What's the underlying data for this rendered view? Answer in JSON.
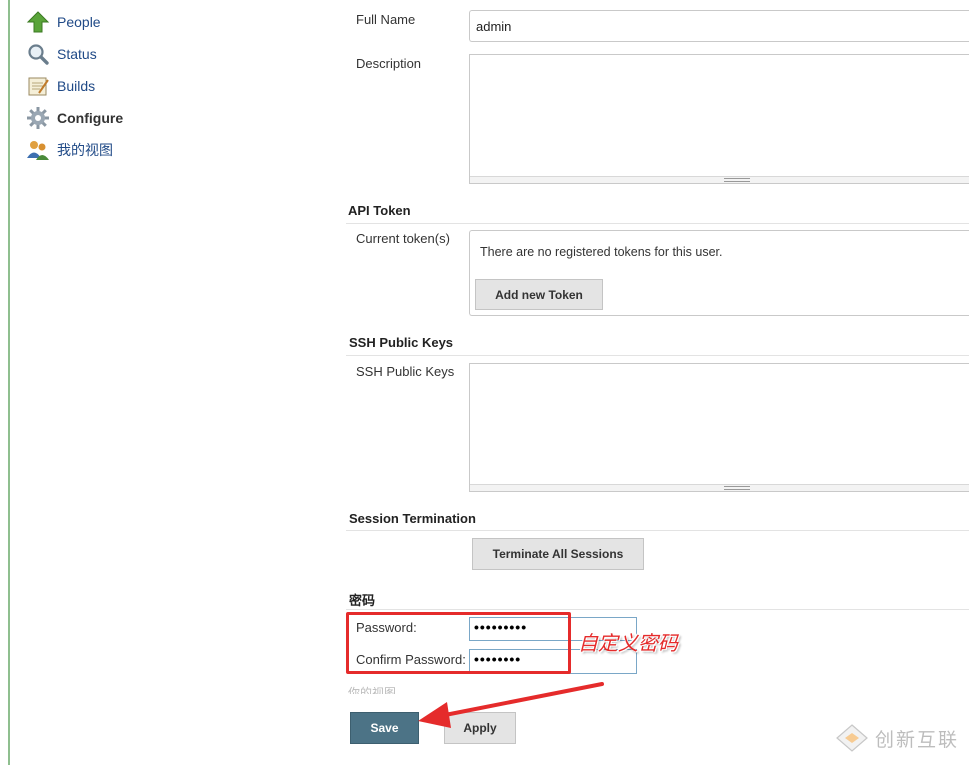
{
  "sidebar": {
    "items": [
      {
        "label": "People",
        "icon": "up-arrow-icon",
        "active": false
      },
      {
        "label": "Status",
        "icon": "search-icon",
        "active": false
      },
      {
        "label": "Builds",
        "icon": "notepad-icon",
        "active": false
      },
      {
        "label": "Configure",
        "icon": "gear-icon",
        "active": true
      },
      {
        "label": "我的视图",
        "icon": "users-icon",
        "active": false
      }
    ]
  },
  "form": {
    "full_name": {
      "label": "Full Name",
      "value": "admin"
    },
    "description": {
      "label": "Description",
      "value": ""
    },
    "api_token": {
      "heading": "API Token",
      "label": "Current token(s)",
      "empty_text": "There are no registered tokens for this user.",
      "add_button": "Add new Token"
    },
    "ssh": {
      "heading": "SSH Public Keys",
      "label": "SSH Public Keys",
      "value": ""
    },
    "session": {
      "heading": "Session Termination",
      "button": "Terminate All Sessions"
    },
    "password": {
      "heading": "密码",
      "password_label": "Password:",
      "password_value": "•••••••••",
      "confirm_label": "Confirm Password:",
      "confirm_value": "••••••••",
      "cut_text": "你的视图"
    },
    "save_button": "Save",
    "apply_button": "Apply"
  },
  "annotation": {
    "text": "自定义密码",
    "color": "#e52b2b"
  },
  "watermark": {
    "text": "创新互联"
  }
}
